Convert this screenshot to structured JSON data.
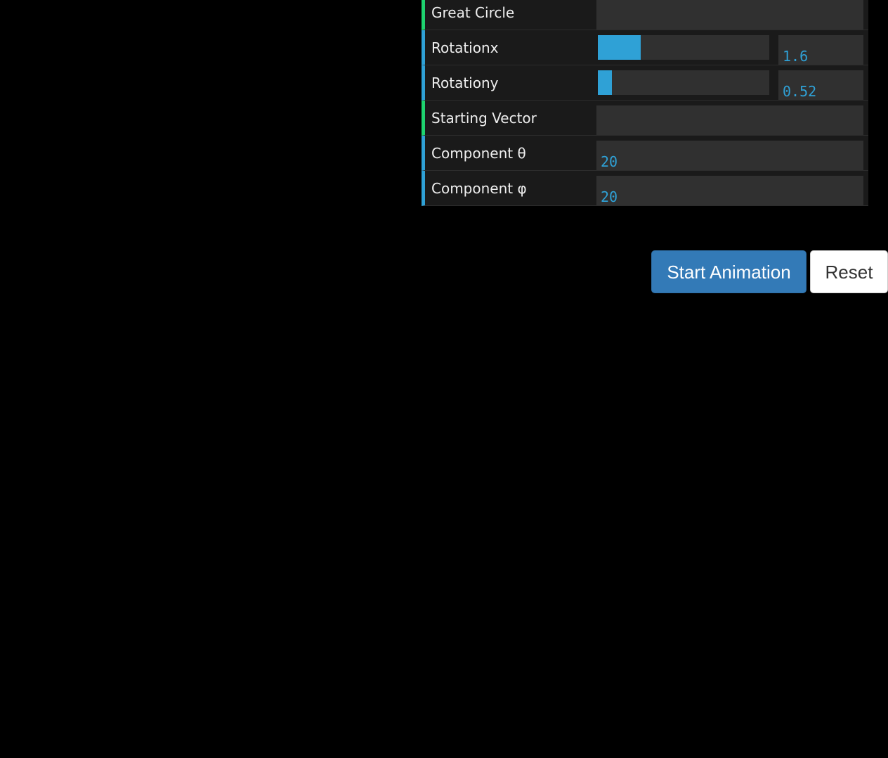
{
  "controls": {
    "great_circle": {
      "label": "Great Circle"
    },
    "rotationx": {
      "label": "Rotationx",
      "value": "1.6",
      "fill_fraction": 0.25
    },
    "rotationy": {
      "label": "Rotationy",
      "value": "0.52",
      "fill_fraction": 0.08
    },
    "starting_vector": {
      "label": "Starting Vector"
    },
    "component_theta": {
      "label": "Component θ",
      "value": "20"
    },
    "component_phi": {
      "label": "Component φ",
      "value": "20"
    }
  },
  "buttons": {
    "start_label": "Start Animation",
    "reset_label": "Reset"
  },
  "colors": {
    "accent": "#2fa1d6",
    "folder_accent": "#1ed36f",
    "primary_button": "#337ab7"
  }
}
